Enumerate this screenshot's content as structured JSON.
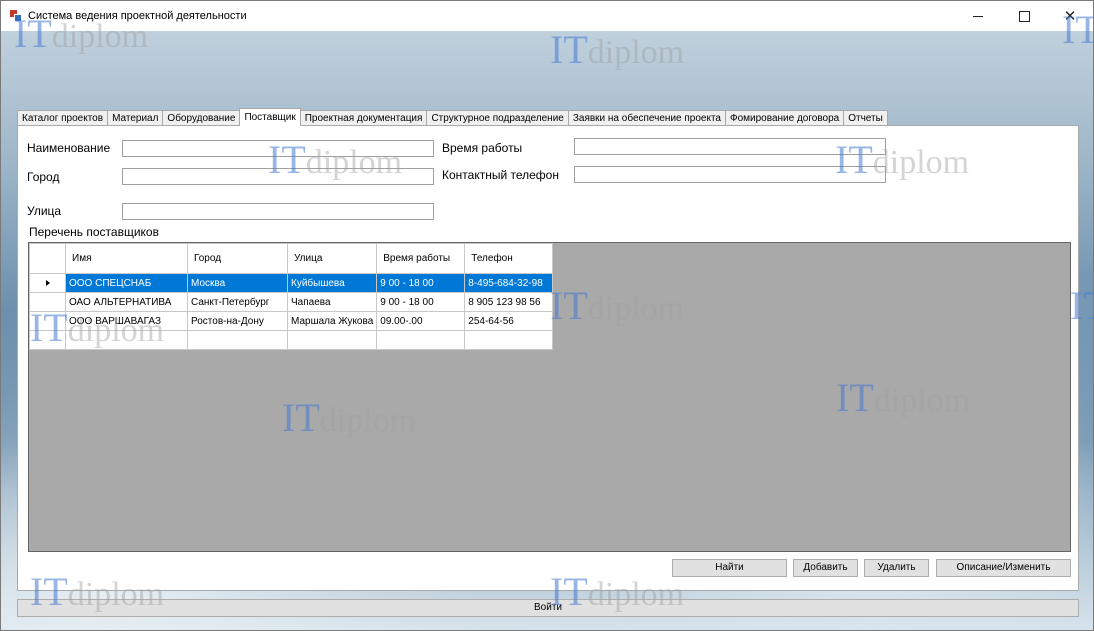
{
  "window": {
    "title": "Система ведения проектной деятельности"
  },
  "tabs": [
    "Каталог проектов",
    "Материал",
    "Оборудование",
    "Поставщик",
    "Проектная документация",
    "Структурное подразделение",
    "Заявки на обеспечение проекта",
    "Фомирование договора",
    "Отчеты"
  ],
  "active_tab": "Поставщик",
  "form": {
    "name_label": "Наименование",
    "city_label": "Город",
    "street_label": "Улица",
    "hours_label": "Время работы",
    "phone_label": "Контактный телефон",
    "name_value": "",
    "city_value": "",
    "street_value": "",
    "hours_value": "",
    "phone_value": ""
  },
  "suppliers": {
    "title": "Перечень поставщиков",
    "columns": [
      "Имя",
      "Город",
      "Улица",
      "Время работы",
      "Телефон"
    ],
    "rows": [
      [
        "ООО СПЕЦСНАБ",
        "Москва",
        "Куйбышева",
        "9 00 - 18 00",
        "8-495-684-32-98"
      ],
      [
        "ОАО АЛЬТЕРНАТИВА",
        "Санкт-Петербург",
        "Чапаева",
        "9 00 - 18 00",
        "8 905 123 98 56"
      ],
      [
        "ООО ВАРШАВАГАЗ",
        "Ростов-на-Дону",
        "Маршала Жукова",
        "09.00-.00",
        "254-64-56"
      ]
    ]
  },
  "buttons": {
    "find": "Найти",
    "add": "Добавить",
    "delete": "Удалить",
    "describe": "Описание/Изменить",
    "login": "Войти"
  },
  "watermark": {
    "it": "IT",
    "rest": "diplom"
  }
}
